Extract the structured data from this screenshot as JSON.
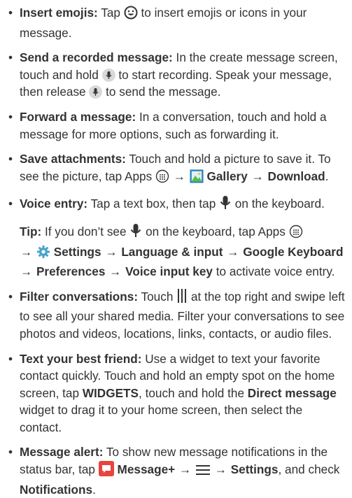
{
  "items": {
    "emojis": {
      "title": "Insert emojis:",
      "t1": " Tap ",
      "t2": " to insert emojis or icons in your message."
    },
    "recorded": {
      "title": "Send a recorded message:",
      "t1": " In the create message screen, touch and hold ",
      "t2": " to start recording. Speak your message, then release ",
      "t3": " to send the message."
    },
    "forward": {
      "title": "Forward a message:",
      "t1": " In a conversation, touch and hold a message for more options, such as forwarding it."
    },
    "save": {
      "title": "Save attachments:",
      "t1": " Touch and hold a picture to save it. To see the picture, tap Apps ",
      "gallery": "Gallery",
      "download": "Download",
      "end": "."
    },
    "voice": {
      "title": "Voice entry:",
      "t1": " Tap a text box, then tap ",
      "t2": " on the keyboard."
    },
    "tip": {
      "title": "Tip:",
      "t1": " If you don’t see ",
      "t2": " on the keyboard, tap Apps ",
      "settings": "Settings",
      "language": "Language & input",
      "keyboard": "Google Keyboard",
      "preferences": "Preferences",
      "voice_key": "Voice input key",
      "t3": " to activate voice entry."
    },
    "filter": {
      "title": "Filter conversations:",
      "t1": " Touch ",
      "t2": " at the top right and swipe left to see all your shared media. Filter your conversations to see photos and videos, locations, links, contacts, or audio files."
    },
    "friend": {
      "title": "Text your best friend:",
      "t1": " Use a widget to text your favorite contact quickly. Touch and hold an empty spot on the home screen, tap ",
      "widgets": "WIDGETS",
      "t2": ", touch and hold the ",
      "direct": "Direct message",
      "t3": " widget to drag it to your home screen, then select the contact."
    },
    "alert": {
      "title": "Message alert:",
      "t1": " To show new message notifications in the status bar, tap ",
      "message_plus": "Message+",
      "settings": "Settings",
      "t2": ", and check ",
      "notifications": "Notifications",
      "end": "."
    }
  },
  "bullet": "•",
  "arrow": "→",
  "colors": {
    "text": "#333333",
    "message_plus_icon": "#e8453c",
    "gallery_icon": "#3a9bd5",
    "settings_icon": "#4aa3c8"
  },
  "icons": [
    "emoji-icon",
    "mic-icon",
    "apps-icon",
    "gallery-icon",
    "settings-icon",
    "vertical-bars-icon",
    "message-plus-icon",
    "menu-icon"
  ]
}
